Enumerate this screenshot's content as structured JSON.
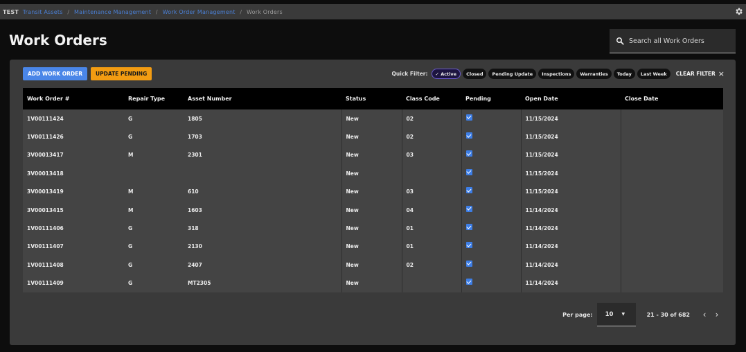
{
  "breadcrumb": {
    "env": "TEST",
    "links": [
      "Transit Assets",
      "Maintenance Management",
      "Work Order Management"
    ],
    "current": "Work Orders"
  },
  "page": {
    "title": "Work Orders"
  },
  "search": {
    "placeholder": "Search all Work Orders"
  },
  "toolbar": {
    "add_label": "ADD WORK ORDER",
    "update_label": "UPDATE PENDING"
  },
  "quick_filter": {
    "label": "Quick Filter:",
    "chips": [
      "✓ Active",
      "Closed",
      "Pending Update",
      "Inspections",
      "Warranties",
      "Today",
      "Last Week"
    ],
    "active": "✓ Active",
    "clear_label": "CLEAR FILTER",
    "clear_icon": "×"
  },
  "table": {
    "columns": [
      "Work Order #",
      "Repair Type",
      "Asset Number",
      "Status",
      "Class Code",
      "Pending",
      "Open Date",
      "Close Date"
    ],
    "rows": [
      {
        "wo": "1V00111424",
        "repair": "G",
        "asset": "1805",
        "status": "New",
        "class": "02",
        "pending": true,
        "open": "11/15/2024",
        "close": ""
      },
      {
        "wo": "1V00111426",
        "repair": "G",
        "asset": "1703",
        "status": "New",
        "class": "02",
        "pending": true,
        "open": "11/15/2024",
        "close": ""
      },
      {
        "wo": "3V00013417",
        "repair": "M",
        "asset": "2301",
        "status": "New",
        "class": "03",
        "pending": true,
        "open": "11/15/2024",
        "close": ""
      },
      {
        "wo": "3V00013418",
        "repair": "",
        "asset": "",
        "status": "New",
        "class": "",
        "pending": true,
        "open": "11/15/2024",
        "close": ""
      },
      {
        "wo": "3V00013419",
        "repair": "M",
        "asset": "610",
        "status": "New",
        "class": "03",
        "pending": true,
        "open": "11/15/2024",
        "close": ""
      },
      {
        "wo": "3V00013415",
        "repair": "M",
        "asset": "1603",
        "status": "New",
        "class": "04",
        "pending": true,
        "open": "11/14/2024",
        "close": ""
      },
      {
        "wo": "1V00111406",
        "repair": "G",
        "asset": "318",
        "status": "New",
        "class": "01",
        "pending": true,
        "open": "11/14/2024",
        "close": ""
      },
      {
        "wo": "1V00111407",
        "repair": "G",
        "asset": "2130",
        "status": "New",
        "class": "01",
        "pending": true,
        "open": "11/14/2024",
        "close": ""
      },
      {
        "wo": "1V00111408",
        "repair": "G",
        "asset": "2407",
        "status": "New",
        "class": "02",
        "pending": true,
        "open": "11/14/2024",
        "close": ""
      },
      {
        "wo": "1V00111409",
        "repair": "G",
        "asset": "MT2305",
        "status": "New",
        "class": "",
        "pending": true,
        "open": "11/14/2024",
        "close": ""
      }
    ]
  },
  "pagination": {
    "per_page_label": "Per page:",
    "per_page_value": "10",
    "range": "21 - 30 of 682",
    "prev_icon": "‹",
    "next_icon": "›"
  },
  "icons": {
    "settings": "gear-icon",
    "search": "search-icon"
  },
  "colors": {
    "accent_blue": "#4a86e8",
    "accent_orange": "#f39c12",
    "link_blue": "#4a7fd4",
    "checkbox": "#3d7ee6"
  }
}
